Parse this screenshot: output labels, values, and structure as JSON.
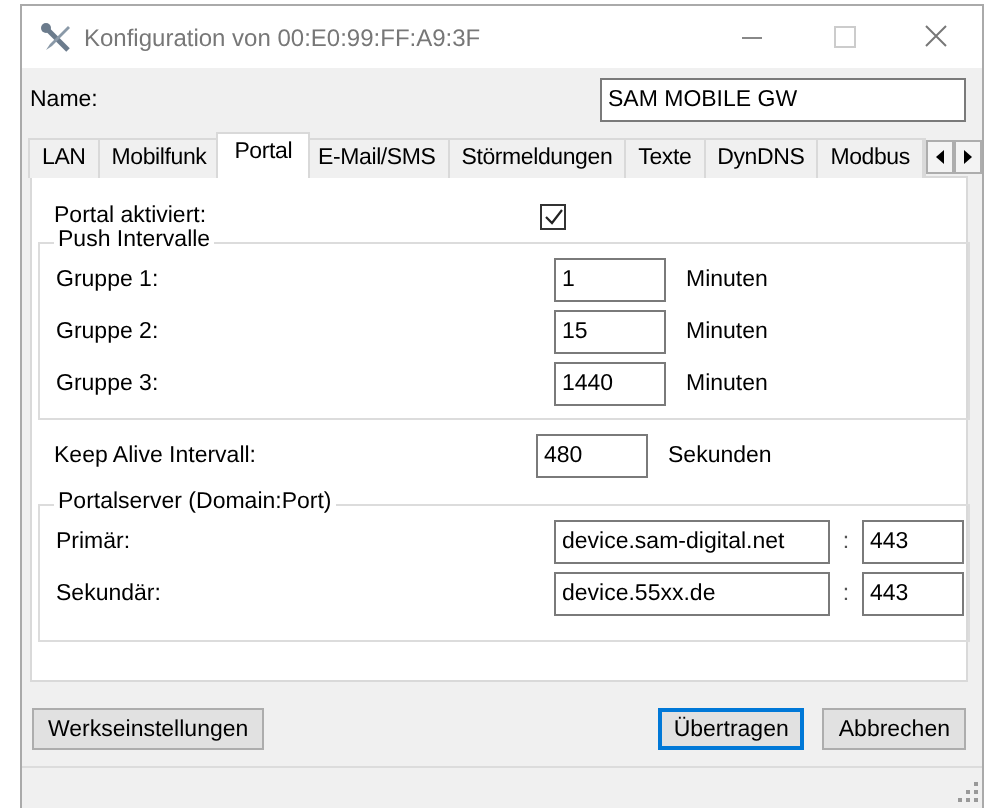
{
  "window": {
    "title": "Konfiguration von 00:E0:99:FF:A9:3F"
  },
  "name": {
    "label": "Name:",
    "value": "SAM MOBILE GW"
  },
  "tabs": [
    {
      "label": "LAN",
      "selected": false
    },
    {
      "label": "Mobilfunk",
      "selected": false
    },
    {
      "label": "Portal",
      "selected": true
    },
    {
      "label": "E-Mail/SMS",
      "selected": false
    },
    {
      "label": "Störmeldungen",
      "selected": false
    },
    {
      "label": "Texte",
      "selected": false
    },
    {
      "label": "DynDNS",
      "selected": false
    },
    {
      "label": "Modbus",
      "selected": false
    }
  ],
  "portal_enabled": {
    "label": "Portal aktiviert:",
    "checked": true
  },
  "push_intervals": {
    "title": "Push Intervalle",
    "rows": [
      {
        "label": "Gruppe 1:",
        "value": "1",
        "unit": "Minuten"
      },
      {
        "label": "Gruppe 2:",
        "value": "15",
        "unit": "Minuten"
      },
      {
        "label": "Gruppe 3:",
        "value": "1440",
        "unit": "Minuten"
      }
    ]
  },
  "keep_alive": {
    "label": "Keep Alive Intervall:",
    "value": "480",
    "unit": "Sekunden"
  },
  "portal_server": {
    "title": "Portalserver (Domain:Port)",
    "rows": [
      {
        "label": "Primär:",
        "domain": "device.sam-digital.net",
        "separator": ":",
        "port": "443"
      },
      {
        "label": "Sekundär:",
        "domain": "device.55xx.de",
        "separator": ":",
        "port": "443"
      }
    ]
  },
  "buttons": [
    {
      "label": "Werkseinstellungen",
      "default": false
    },
    {
      "label": "Übertragen",
      "default": true
    },
    {
      "label": "Abbrechen",
      "default": false
    }
  ]
}
